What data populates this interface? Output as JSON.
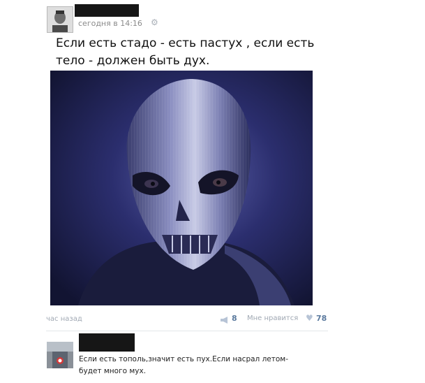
{
  "post": {
    "time": "сегодня в 14:16",
    "text": "Если есть стадо - есть пастух , если есть тело - должен быть дух."
  },
  "footer": {
    "time_ago": "час назад",
    "shares": "8",
    "like_label": "Мне нравится",
    "likes": "78"
  },
  "comment": {
    "text": "Если есть тополь,значит есть пух.Если насрал летом-будет много мух."
  },
  "icons": {
    "settings": "gear-icon",
    "share": "megaphone-icon",
    "like": "heart-icon"
  },
  "colors": {
    "link": "#5b7a9e",
    "muted": "#a0a8b3"
  }
}
